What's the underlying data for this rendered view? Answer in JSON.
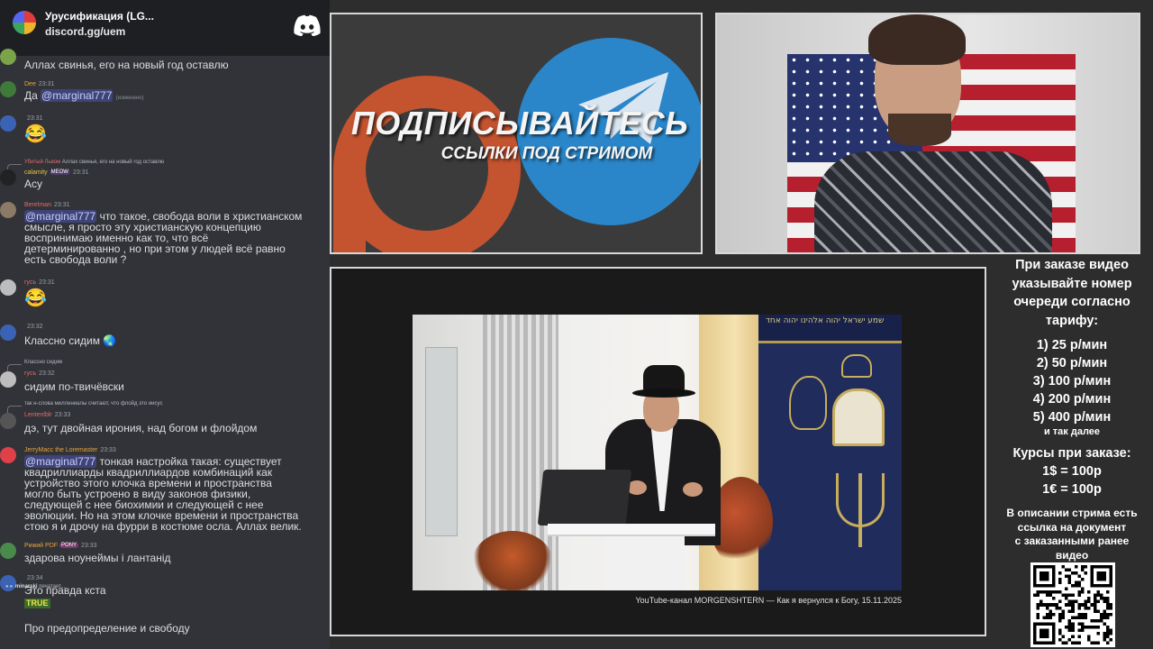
{
  "chat": {
    "server_name": "Урусификация (LG...",
    "invite": "discord.gg/uem",
    "messages": [
      {
        "text": "Аллах свинья, его на новый год оставлю"
      },
      {
        "user": "Dee",
        "time": "23:31",
        "mention": "@marginal777",
        "text": "Да ",
        "edited": "(изменено)"
      },
      {
        "user": "",
        "time": "23:31",
        "emoji": "😂"
      },
      {
        "reply_user": "Убитый Львом",
        "reply_text": "Аллах свинья, его на новый год оставлю",
        "user": "calamity",
        "badge": "MEOW",
        "time": "23:31",
        "text": "Асу"
      },
      {
        "user": "Berelman",
        "time": "23:31",
        "mention": "@marginal777",
        "text_lines": [
          " что такое, свобода воли в христианском",
          "смысле, я просто эту христианскую концепцию",
          "воспринимаю именно как то, что всё",
          "детерминированно , но при этом у людей всё равно",
          "есть свобода воли ?"
        ]
      },
      {
        "user": "гусь",
        "time": "23:31",
        "emoji": "😂"
      },
      {
        "user": "",
        "time": "23:32",
        "text": "Классно сидим"
      },
      {
        "reply_user": "",
        "reply_text": "Классно сидим",
        "user": "гусь",
        "time": "23:32",
        "text": "сидим по-твичёвски"
      },
      {
        "reply_user": "",
        "reply_text": "так н-слова миллениалы считают, что флойд это иисус",
        "user": "Lentenlblr",
        "time": "23:33",
        "text": "дэ, тут двойная ирония, над богом и флойдом"
      },
      {
        "user": "JerryMacc the Loremaster",
        "time": "23:33",
        "mention": "@marginal777",
        "text_lines": [
          " тонкая настройка такая: существует",
          "квадриллиарды квадриллиардов комбинаций как",
          "устройство этого клочка времени и пространства",
          "могло быть устроено в виду законов физики,",
          "следующей с нее биохимии и следующей с нее",
          "эволюции. Но на этом клочке времени и пространства",
          "стою я и дрочу на фурри в костюме осла. Аллах велик."
        ]
      },
      {
        "user": "Рижий PDF",
        "badge": "PONY",
        "time": "23:33",
        "text": "здарова ноунеймы і лантанід"
      },
      {
        "user": "",
        "time": "23:34",
        "text": "Это правда кста",
        "sticker": "TRUE",
        "text2": "Про предопределение и свободу"
      }
    ],
    "typing_user": "minarski",
    "typing_text": " печатает..."
  },
  "promo": {
    "title": "ПОДПИСЫВАЙТЕСЬ",
    "subtitle": "ССЫЛКИ ПОД СТРИМОМ"
  },
  "video": {
    "hebrew_banner": "שמע ישראל יהוה אלהינו יהוה אחד",
    "caption": "YouTube-канал MORGENSHTERN — Как я вернулся к Богу, 15.11.2025"
  },
  "info": {
    "header_lines": [
      "При заказе видео",
      "указывайте номер",
      "очереди согласно",
      "тарифу:"
    ],
    "tariffs": [
      "1) 25 р/мин",
      "2) 50 р/мин",
      "3) 100 р/мин",
      "4) 200 р/мин",
      "5) 400 р/мин"
    ],
    "tariffs_more": "и так далее",
    "rates_header": "Курсы при заказе:",
    "rates": [
      "1$ = 100р",
      "1€ = 100р"
    ],
    "description_lines": [
      "В описании стрима есть",
      "ссылка на документ",
      "с заказанными ранее",
      "видео"
    ]
  },
  "colors": {
    "chat_bg": "#313338",
    "header_bg": "#1e1f22",
    "mention_bg": "#3c4270",
    "promo_orange": "#c4532f",
    "promo_blue": "#2a86c9"
  }
}
